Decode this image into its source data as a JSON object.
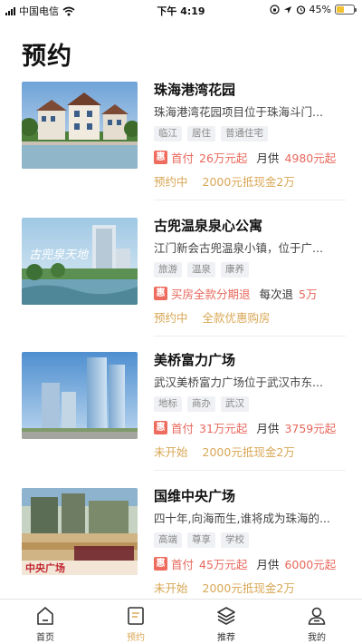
{
  "status_bar": {
    "carrier": "中国电信",
    "time": "下午 4:19",
    "battery": "45%",
    "battery_level": 0.45
  },
  "page_title": "预约",
  "items": [
    {
      "name": "珠海港湾花园",
      "desc": "珠海港湾花园项目位于珠海斗门...",
      "tags": [
        "临江",
        "居住",
        "普通住宅"
      ],
      "promo_icon": "惠",
      "promo_a_label": "首付",
      "promo_a_value": "26万元起",
      "promo_b_label": "月供",
      "promo_b_value": "4980元起",
      "status": "预约中",
      "status_sub": "2000元抵现金2万"
    },
    {
      "name": "古兜温泉泉心公寓",
      "desc": "江门新会古兜温泉小镇，位于广...",
      "tags": [
        "旅游",
        "温泉",
        "康养"
      ],
      "promo_icon": "惠",
      "promo_a_label": "",
      "promo_a_value": "买房全款分期退",
      "promo_b_label": "每次退",
      "promo_b_value": "5万",
      "status": "预约中",
      "status_sub": "全款优惠购房"
    },
    {
      "name": "美桥富力广场",
      "desc": "武汉美桥富力广场位于武汉市东...",
      "tags": [
        "地标",
        "商办",
        "武汉"
      ],
      "promo_icon": "惠",
      "promo_a_label": "首付",
      "promo_a_value": "31万元起",
      "promo_b_label": "月供",
      "promo_b_value": "3759元起",
      "status": "未开始",
      "status_sub": "2000元抵现金2万"
    },
    {
      "name": "国维中央广场",
      "desc": "四十年,向海而生,谁将成为珠海的...",
      "tags": [
        "高端",
        "尊享",
        "学校"
      ],
      "promo_icon": "惠",
      "promo_a_label": "首付",
      "promo_a_value": "45万元起",
      "promo_b_label": "月供",
      "promo_b_value": "6000元起",
      "status": "未开始",
      "status_sub": "2000元抵现金2万"
    }
  ],
  "thumb_text": {
    "item1": "古兜泉天地",
    "item3_top": "中央广场"
  },
  "tabs": [
    {
      "label": "首页",
      "icon": "home-icon",
      "active": false
    },
    {
      "label": "预约",
      "icon": "reservation-icon",
      "active": true
    },
    {
      "label": "推荐",
      "icon": "layers-icon",
      "active": false
    },
    {
      "label": "我的",
      "icon": "profile-icon",
      "active": false
    }
  ],
  "colors": {
    "accent": "#d8a755",
    "promo_red": "#e8685c",
    "badge_red": "#ee6b5e"
  }
}
